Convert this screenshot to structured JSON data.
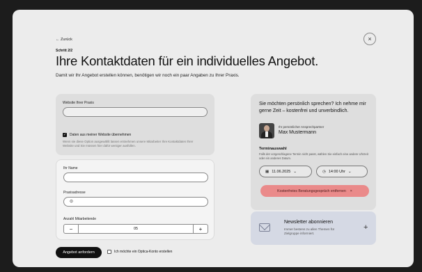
{
  "nav": {
    "back_label": "← Zurück",
    "close_glyph": "×"
  },
  "header": {
    "step": "Schritt 2/2",
    "title": "Ihre Kontaktdaten für ein individuelles Angebot.",
    "subtitle": "Damit wir Ihr Angebot erstellen können, benötigen wir noch ein paar Angaben zu Ihrer Praxis."
  },
  "website_card": {
    "website_label": "Website Ihrer Praxis",
    "website_value": "",
    "checkbox_label": "Daten aus meiner Website übernehmen",
    "checkbox_checked": true,
    "hint": "Wenn sie diese Option ausgewählt lassen entnehmen unsere Mitarbeiter Ihre Kontaktdaten Ihrer Website und Sie müssen hier dafür weniger ausfüllen."
  },
  "details_card": {
    "name_label": "Ihr Name",
    "name_value": "",
    "address_label": "Praxisadresse",
    "address_icon": "location-pin-icon",
    "employees_label": "Anzahl Mitarbeitende",
    "employees_value": "05",
    "minus_glyph": "−",
    "plus_glyph": "+"
  },
  "footer": {
    "submit_label": "Angebot anfordern",
    "optin_label": "Ich möchte ein Optica-Konto erstellen",
    "optin_checked": false
  },
  "contact_card": {
    "question": "Sie möchten persönlich sprechen? Ich nehme mir gerne Zeit – kostenfrei und unverbindlich.",
    "role": "Ihr persönlicher Ansprechpartner",
    "name": "Max Mustermann",
    "termin_title": "Terminauswahl",
    "termin_hint": "Falls der vorgeschlagene Termin nicht passt, wählen Sie einfach eine andere Uhrzeit oder ein anderes Datum.",
    "date": "11.06.2025",
    "time": "14:00 Uhr",
    "remove_label": "Kostenfreies Beratungsgespräch entfernen",
    "remove_glyph": "×"
  },
  "newsletter": {
    "title": "Newsletter abonnieren",
    "description": "Immer bestens zu allen Themen für Zielgruppe informiert.",
    "plus_glyph": "+"
  },
  "colors": {
    "remove_bg": "#ea8a8a",
    "newsletter_bg": "#d5d9e4",
    "submit_bg": "#111111"
  }
}
